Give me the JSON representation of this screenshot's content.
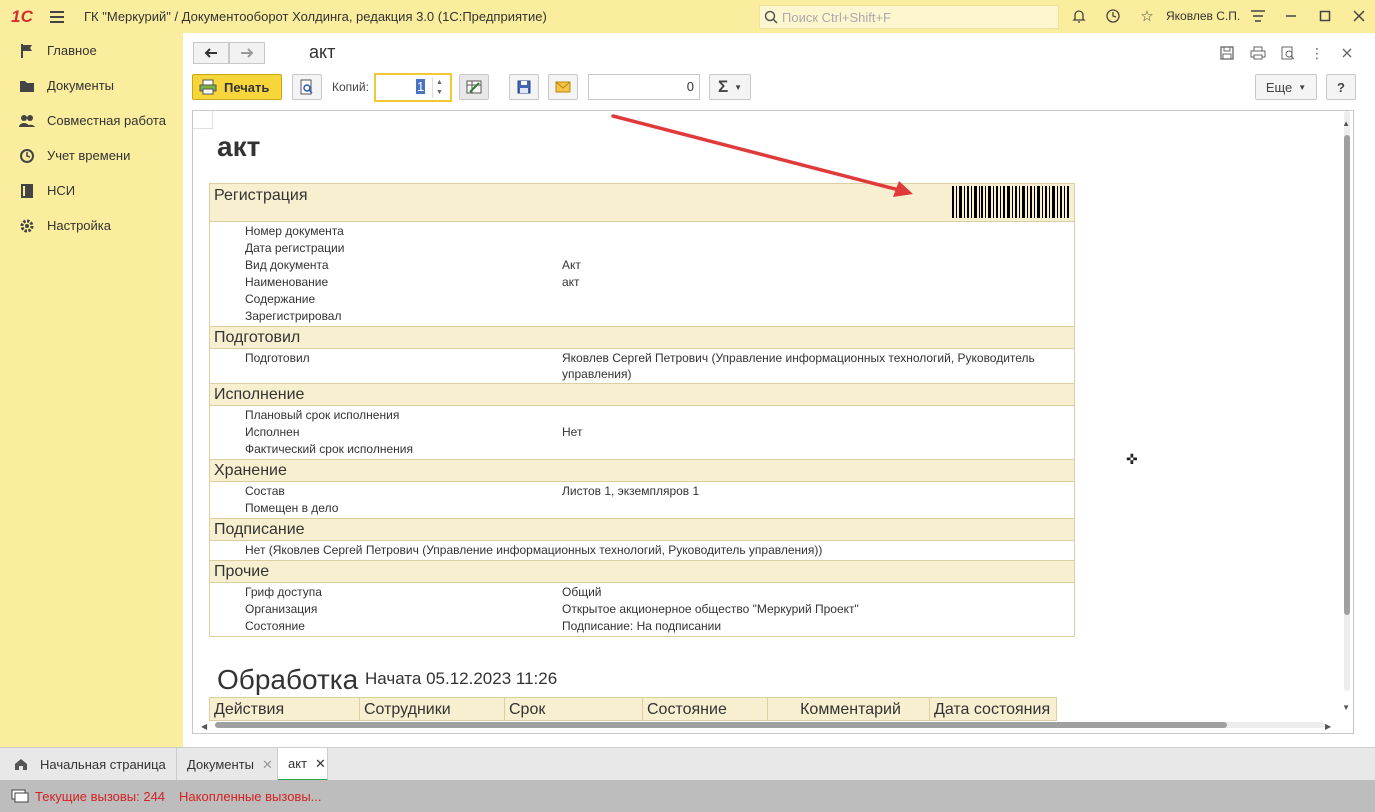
{
  "app": {
    "logo": "1С",
    "title": "ГК \"Меркурий\" / Документооборот Холдинга, редакция 3.0  (1С:Предприятие)",
    "search_placeholder": "Поиск Ctrl+Shift+F",
    "user": "Яковлев С.П."
  },
  "sidebar": {
    "items": [
      {
        "label": "Главное",
        "icon": "flag-icon"
      },
      {
        "label": "Документы",
        "icon": "folder-icon"
      },
      {
        "label": "Совместная работа",
        "icon": "people-icon"
      },
      {
        "label": "Учет времени",
        "icon": "clock-icon"
      },
      {
        "label": "НСИ",
        "icon": "book-icon"
      },
      {
        "label": "Настройка",
        "icon": "gear-icon"
      }
    ]
  },
  "window": {
    "title": "акт"
  },
  "toolbar": {
    "print_label": "Печать",
    "copies_label": "Копий:",
    "copies_value": "1",
    "number_value": "0",
    "sum_symbol": "Σ",
    "more_label": "Еще",
    "help_label": "?"
  },
  "document": {
    "heading": "акт",
    "sections": [
      {
        "title": "Регистрация",
        "rows": [
          {
            "k": "Номер документа",
            "v": ""
          },
          {
            "k": "Дата регистрации",
            "v": ""
          },
          {
            "k": "Вид документа",
            "v": "Акт"
          },
          {
            "k": "Наименование",
            "v": "акт"
          },
          {
            "k": "Содержание",
            "v": ""
          },
          {
            "k": "Зарегистрировал",
            "v": ""
          }
        ]
      },
      {
        "title": "Подготовил",
        "rows": [
          {
            "k": "Подготовил",
            "v": "Яковлев Сергей Петрович (Управление информационных технологий, Руководитель управления)"
          }
        ]
      },
      {
        "title": "Исполнение",
        "rows": [
          {
            "k": "Плановый срок исполнения",
            "v": ""
          },
          {
            "k": "Исполнен",
            "v": "Нет"
          },
          {
            "k": "Фактический срок исполнения",
            "v": ""
          }
        ]
      },
      {
        "title": "Хранение",
        "rows": [
          {
            "k": "Состав",
            "v": "Листов 1, экземпляров 1"
          },
          {
            "k": "Помещен в дело",
            "v": ""
          }
        ]
      },
      {
        "title": "Подписание",
        "rows": [
          {
            "k": "Нет (Яковлев Сергей Петрович (Управление информационных технологий, Руководитель управления))",
            "v": ""
          }
        ]
      },
      {
        "title": "Прочие",
        "rows": [
          {
            "k": "Гриф доступа",
            "v": "Общий"
          },
          {
            "k": "Организация",
            "v": "Открытое акционерное общество \"Меркурий Проект\""
          },
          {
            "k": "Состояние",
            "v": "Подписание: На подписании"
          }
        ]
      }
    ],
    "processing_title": "Обработка",
    "processing_started": "Начата 05.12.2023 11:26",
    "columns": [
      "Действия",
      "Сотрудники",
      "Срок",
      "Состояние",
      "Комментарий",
      "Дата состояния"
    ]
  },
  "tabs": [
    {
      "label": "Начальная страница",
      "icon": "home-icon",
      "closable": false,
      "active": false
    },
    {
      "label": "Документы",
      "closable": true,
      "active": false
    },
    {
      "label": "акт",
      "closable": true,
      "active": true
    }
  ],
  "status": {
    "current_calls": "Текущие вызовы: 244",
    "accumulated_calls": "Накопленные вызовы..."
  },
  "colors": {
    "accent": "#fbed9e",
    "print_button": "#f7d63c",
    "status_text": "#d42222",
    "annotation_arrow": "#e03a3a"
  }
}
